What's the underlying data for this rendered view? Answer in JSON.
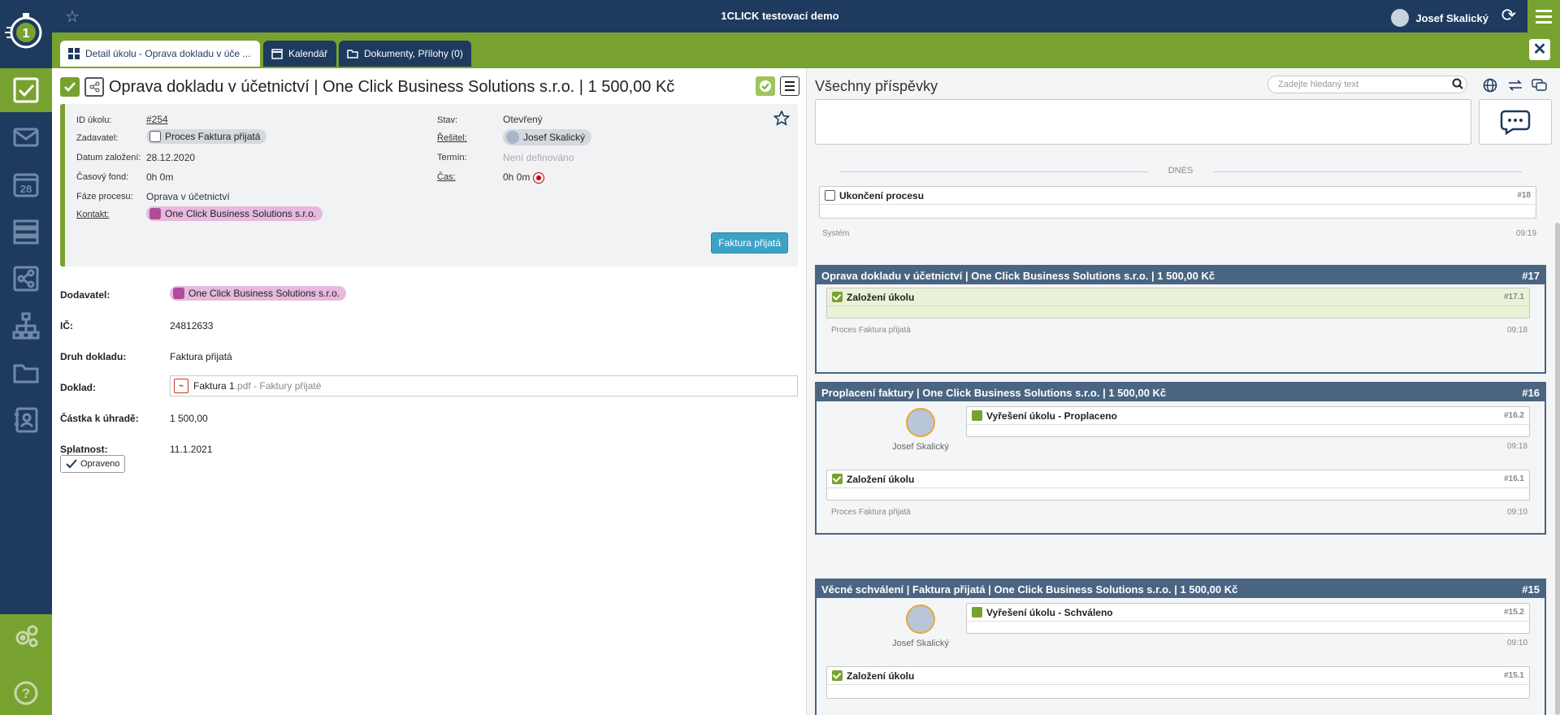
{
  "app": {
    "title": "1CLICK testovací demo",
    "user": "Josef Skalický"
  },
  "tabs": [
    {
      "label": "Detail úkolu - Oprava dokladu v úče ..."
    },
    {
      "label": "Kalendář"
    },
    {
      "label": "Dokumenty, Přílohy (0)"
    }
  ],
  "task": {
    "title": "Oprava dokladu v účetnictví | One Click Business Solutions s.r.o. | 1 500,00 Kč",
    "labels": {
      "id": "ID úkolu:",
      "zadavatel": "Zadavatel:",
      "datum": "Datum založení:",
      "fond": "Časový fond:",
      "faze": "Fáze procesu:",
      "kontakt": "Kontakt:",
      "stav": "Stav:",
      "resitel": "Řešitel:",
      "termin": "Termín:",
      "cas": "Čas:"
    },
    "values": {
      "id": "#254",
      "zadavatel": "Proces Faktura přijatá",
      "datum": "28.12.2020",
      "fond": "0h 0m",
      "faze": "Oprava v účetnictví",
      "kontakt": "One Click Business Solutions s.r.o.",
      "stav": "Otevřený",
      "resitel": "Josef Skalický",
      "termin": "Není definováno",
      "cas": "0h 0m"
    },
    "action_button": "Faktura přijatá"
  },
  "fields": [
    {
      "label": "Dodavatel:",
      "value": "One Click Business Solutions s.r.o."
    },
    {
      "label": "IČ:",
      "value": "24812633"
    },
    {
      "label": "Druh dokladu:",
      "value": "Faktura přijatá"
    },
    {
      "label": "Doklad:",
      "file": "Faktura 1",
      "ext": ".pdf - Faktury přijaté"
    },
    {
      "label": "Částka k úhradě:",
      "value": "1 500,00"
    },
    {
      "label": "Splatnost:",
      "value": "11.1.2021"
    }
  ],
  "opraveno_button": "Opraveno",
  "right": {
    "title": "Všechny příspěvky",
    "search_placeholder": "Zadejte hledaný text",
    "divider": "DNES",
    "posts": {
      "p18": {
        "title": "Ukončení procesu",
        "num": "#18",
        "author": "Systém",
        "time": "09:19"
      },
      "t17": {
        "title": "Oprava dokladu v účetnictví | One Click Business Solutions s.r.o. | 1 500,00 Kč",
        "num": "#17"
      },
      "p171": {
        "title": "Založení úkolu",
        "num": "#17.1",
        "author": "Proces Faktura přijatá",
        "time": "09:18"
      },
      "t16": {
        "title": "Proplacení faktury | One Click Business Solutions s.r.o. | 1 500,00 Kč",
        "num": "#16"
      },
      "p162": {
        "title": "Vyřešení úkolu - Proplaceno",
        "num": "#16.2",
        "author": "Josef Skalický",
        "time": "09:18"
      },
      "p161": {
        "title": "Založení úkolu",
        "num": "#16.1",
        "author": "Proces Faktura přijatá",
        "time": "09:10"
      },
      "t15": {
        "title": "Věcné schválení | Faktura přijatá | One Click Business Solutions s.r.o. | 1 500,00 Kč",
        "num": "#15"
      },
      "p152": {
        "title": "Vyřešení úkolu - Schváleno",
        "num": "#15.2",
        "author": "Josef Skalický",
        "time": "09:10"
      },
      "p151": {
        "title": "Založení úkolu",
        "num": "#15.1"
      }
    }
  },
  "icons": [
    "logo-icon",
    "star-icon",
    "refresh-icon",
    "hamburger-icon",
    "close-icon",
    "tasks-icon",
    "mail-icon",
    "calendar-icon",
    "list-icon",
    "process-icon",
    "org-icon",
    "folder-icon",
    "contacts-icon",
    "settings-icon",
    "help-icon",
    "search-icon",
    "globe-icon",
    "swap-icon",
    "chat-icon"
  ],
  "colors": {
    "navy": "#1e3a5f",
    "green": "#78a22f",
    "thread": "#4a6581",
    "blue_button": "#3ea1c6"
  }
}
